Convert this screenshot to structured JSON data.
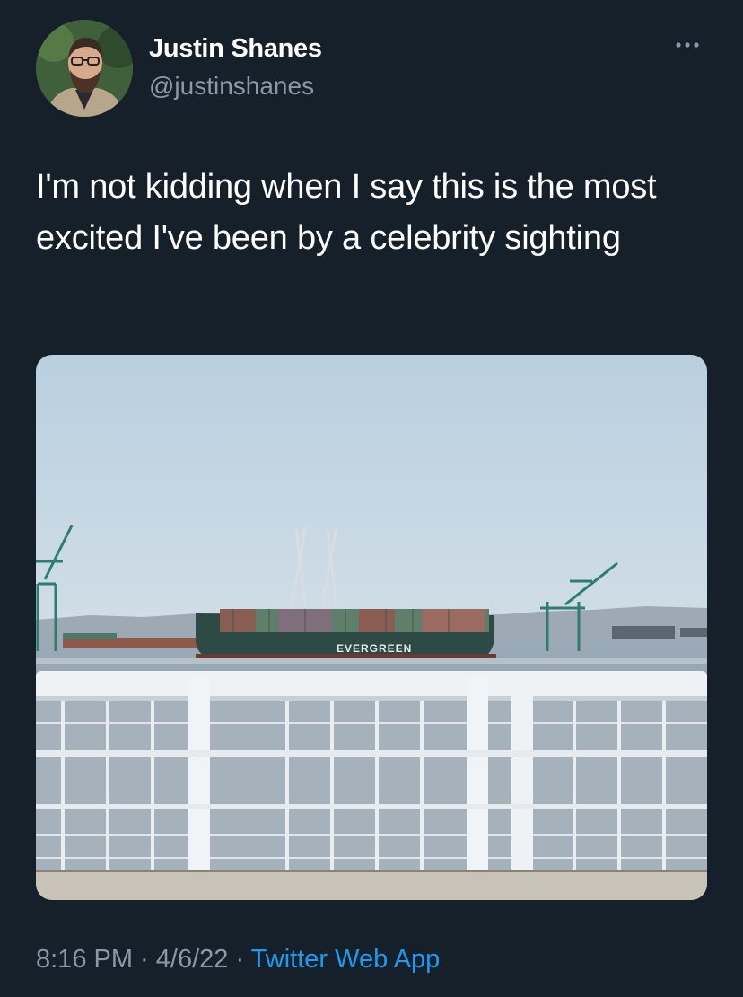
{
  "author": {
    "name": "Justin Shanes",
    "handle": "@justinshanes"
  },
  "more_icon": "more-horizontal-icon",
  "tweet": {
    "text": "I'm not kidding when I say this is the most excited I've been by a celebrity sighting"
  },
  "photo": {
    "ship_hull_text": "EVERGREEN"
  },
  "meta": {
    "time": "8:16 PM",
    "separator1": " · ",
    "date": "4/6/22",
    "separator2": " · ",
    "source": "Twitter Web App"
  },
  "colors": {
    "background": "#15202b",
    "secondary_text": "#8b98a5",
    "link": "#1d9bf0"
  }
}
